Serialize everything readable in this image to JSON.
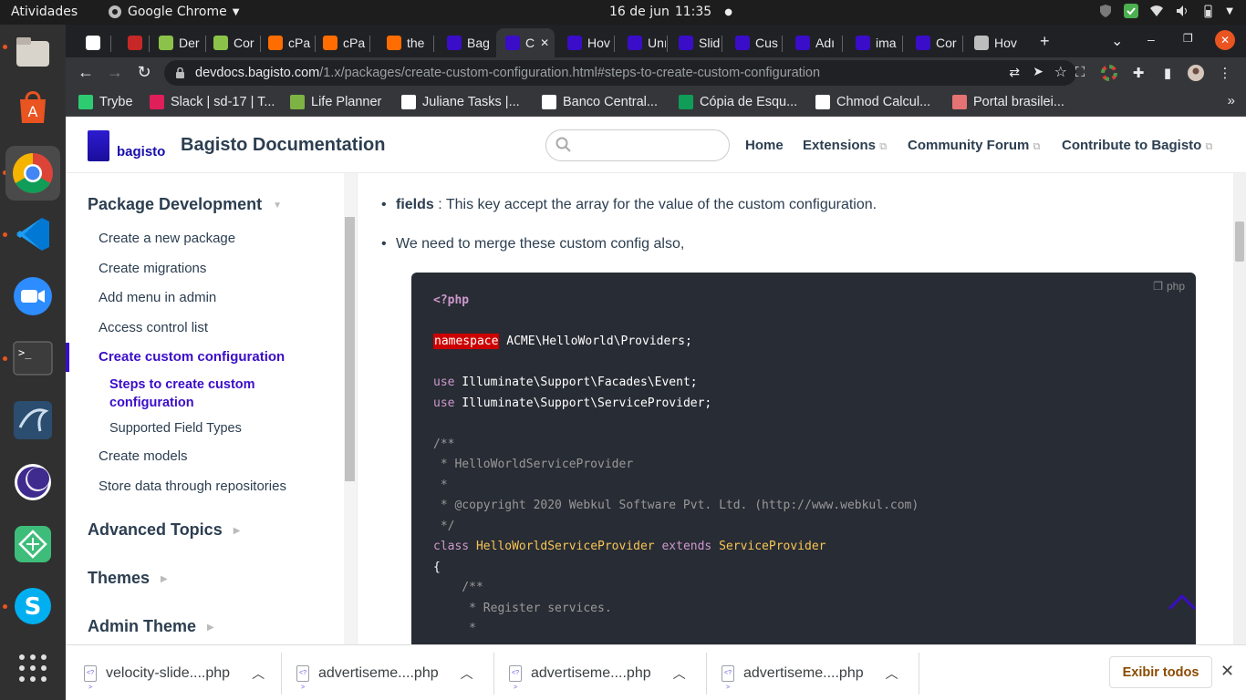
{
  "topbar": {
    "activities": "Atividades",
    "app_name": "Google Chrome",
    "date": "16 de jun",
    "time": "11:35"
  },
  "tabs": [
    {
      "label": "",
      "color": "#ffffff"
    },
    {
      "label": "",
      "color": "#c62828"
    },
    {
      "label": "Der",
      "color": "#8bc34a"
    },
    {
      "label": "Cor",
      "color": "#8bc34a"
    },
    {
      "label": "cPa",
      "color": "#ff6d00"
    },
    {
      "label": "cPa",
      "color": "#ff6d00"
    },
    {
      "label": "the",
      "color": "#ff6d00"
    },
    {
      "label": "Bag",
      "color": "#3a0dc9"
    },
    {
      "label": "C",
      "color": "#3a0dc9"
    },
    {
      "label": "Hov",
      "color": "#3a0dc9"
    },
    {
      "label": "Unı",
      "color": "#3a0dc9"
    },
    {
      "label": "Slid",
      "color": "#3a0dc9"
    },
    {
      "label": "Cus",
      "color": "#3a0dc9"
    },
    {
      "label": "Adı",
      "color": "#3a0dc9"
    },
    {
      "label": "ima",
      "color": "#3a0dc9"
    },
    {
      "label": "Cor",
      "color": "#3a0dc9"
    },
    {
      "label": "Hov",
      "color": "#bdbdbd"
    }
  ],
  "url": {
    "host": "devdocs.bagisto.com",
    "path": "/1.x/packages/create-custom-configuration.html#steps-to-create-custom-configuration"
  },
  "bookmarks": [
    {
      "label": "Trybe",
      "color": "#2ecc71"
    },
    {
      "label": "Slack | sd-17 | T...",
      "color": "#e01e5a"
    },
    {
      "label": "Life Planner",
      "color": "#7cb342"
    },
    {
      "label": "Juliane Tasks |...",
      "color": "#ffffff"
    },
    {
      "label": "Banco Central...",
      "color": "#ffffff"
    },
    {
      "label": "Cópia de Esqu...",
      "color": "#0f9d58"
    },
    {
      "label": "Chmod Calcul...",
      "color": "#ffffff"
    },
    {
      "label": "Portal brasilei...",
      "color": "#e57373"
    }
  ],
  "site": {
    "logo_text": "bagisto",
    "title": "Bagisto Documentation",
    "nav": [
      "Home",
      "Extensions",
      "Community Forum",
      "Contribute to Bagisto"
    ]
  },
  "sidebar": {
    "section_package": "Package Development",
    "links": [
      "Create a new package",
      "Create migrations",
      "Add menu in admin",
      "Access control list",
      "Create custom configuration",
      "Create models",
      "Store data through repositories"
    ],
    "subs": [
      "Steps to create custom configuration",
      "Supported Field Types"
    ],
    "sections": [
      "Advanced Topics",
      "Themes",
      "Admin Theme"
    ]
  },
  "content": {
    "fields_key": "fields",
    "fields_text": " : This key accept the array for the value of the custom configuration.",
    "merge_text": "We need to merge these custom config also,",
    "code_lang": "php",
    "code": {
      "l1": "<?php",
      "ns_kw": "namespace",
      "ns_val": " ACME\\HelloWorld\\Providers;",
      "use1": " Illuminate\\Support\\Facades\\Event;",
      "use2": " Illuminate\\Support\\ServiceProvider;",
      "use_kw": "use",
      "c1": "/**",
      "c2": " * HelloWorldServiceProvider",
      "c3": " *",
      "c4": " * @copyright 2020 Webkul Software Pvt. Ltd. (http://www.webkul.com)",
      "c5": " */",
      "class_kw": "class",
      "class_name": " HelloWorldServiceProvider ",
      "extends_kw": "extends",
      "parent": " ServiceProvider",
      "brace": "{",
      "d1": "    /**",
      "d2": "     * Register services.",
      "d3": "     *"
    }
  },
  "downloads": {
    "items": [
      "velocity-slide....php",
      "advertiseme....php",
      "advertiseme....php",
      "advertiseme....php"
    ],
    "show_all": "Exibir todos"
  }
}
